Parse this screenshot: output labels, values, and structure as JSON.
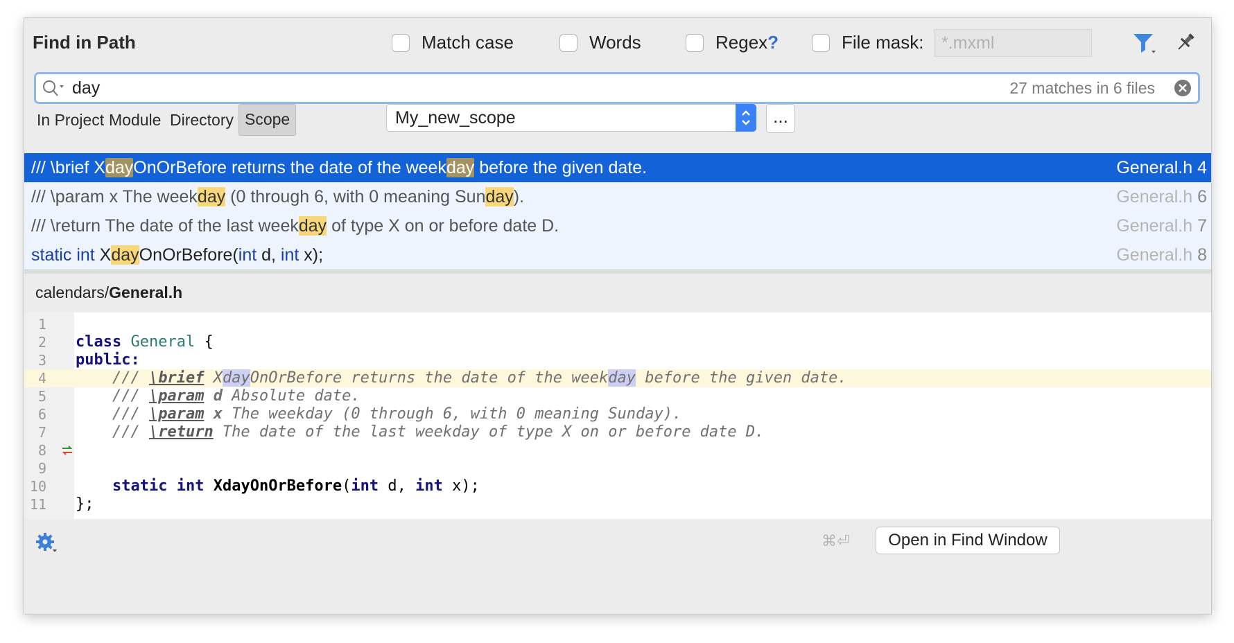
{
  "dialog": {
    "title": "Find in Path"
  },
  "options": {
    "match_case": "Match case",
    "words": "Words",
    "regex": "Regex",
    "regex_help": "?",
    "file_mask": "File mask:",
    "file_mask_placeholder": "*.mxml"
  },
  "search": {
    "query": "day",
    "match_count": "27 matches in 6 files"
  },
  "scope_tabs": [
    {
      "label": "In Project",
      "mnemonic": "P"
    },
    {
      "label": "Module",
      "mnemonic": "M"
    },
    {
      "label": "Directory",
      "mnemonic": "D"
    },
    {
      "label": "Scope",
      "mnemonic": "S",
      "active": true
    }
  ],
  "scope_value": "My_new_scope",
  "more_label": "...",
  "results": [
    {
      "parts": [
        "/// \\brief X",
        "day",
        "OnOrBefore returns the date of the week",
        "day",
        " before the given date."
      ],
      "file": "General.h",
      "line": "4",
      "selected": true
    },
    {
      "parts": [
        "/// \\param x The week",
        "day",
        " (0 through 6, with 0 meaning Sun",
        "day",
        ")."
      ],
      "file": "General.h",
      "line": "6"
    },
    {
      "parts": [
        "/// \\return The date of the last week",
        "day",
        " of type X on or before date D."
      ],
      "file": "General.h",
      "line": "7"
    },
    {
      "parts": [
        "static",
        " ",
        "int",
        " X",
        "day",
        "OnOrBefore(",
        "int",
        " d, ",
        "int",
        " x);"
      ],
      "file": "General.h",
      "line": "8"
    }
  ],
  "preview": {
    "dir": "calendars/",
    "file": "General.h",
    "line_numbers": [
      "1",
      "2",
      "3",
      "4",
      "5",
      "6",
      "7",
      "8",
      "9",
      "10",
      "11"
    ],
    "code": {
      "l2_kw": "class",
      "l2_name": "General",
      "l2_rest": " {",
      "l3": "public:",
      "l4_a": "    /// ",
      "l4_tag": "\\brief",
      "l4_b": " X",
      "l4_hl1": "day",
      "l4_c": "OnOrBefore returns the date of the week",
      "l4_hl2": "day",
      "l4_d": " before the given date.",
      "l5_a": "    /// ",
      "l5_tag": "\\param",
      "l5_b": " ",
      "l5_p": "d",
      "l5_c": " Absolute date.",
      "l6_a": "    /// ",
      "l6_tag": "\\param",
      "l6_b": " ",
      "l6_p": "x",
      "l6_c": " The weekday (0 through 6, with 0 meaning Sunday).",
      "l7_a": "    /// ",
      "l7_tag": "\\return",
      "l7_c": " The date of the last weekday of type X on or before date D.",
      "l8_ind": "    ",
      "l8_static": "static",
      "l8_sp1": " ",
      "l8_int": "int",
      "l8_sp2": " ",
      "l8_fn": "XdayOnOrBefore",
      "l8_p1": "(",
      "l8_int2": "int",
      "l8_p2": " d, ",
      "l8_int3": "int",
      "l8_p3": " x);",
      "l11": "};"
    }
  },
  "footer": {
    "shortcut": "⌘⏎",
    "open_button": "Open in Find Window"
  },
  "colors": {
    "selection": "#1362d8",
    "match_highlight": "#f8d77a",
    "accent": "#3a82f7"
  },
  "icons": [
    "search-icon",
    "clear-icon",
    "filter-icon",
    "pin-icon",
    "gear-icon",
    "implements-icon"
  ]
}
